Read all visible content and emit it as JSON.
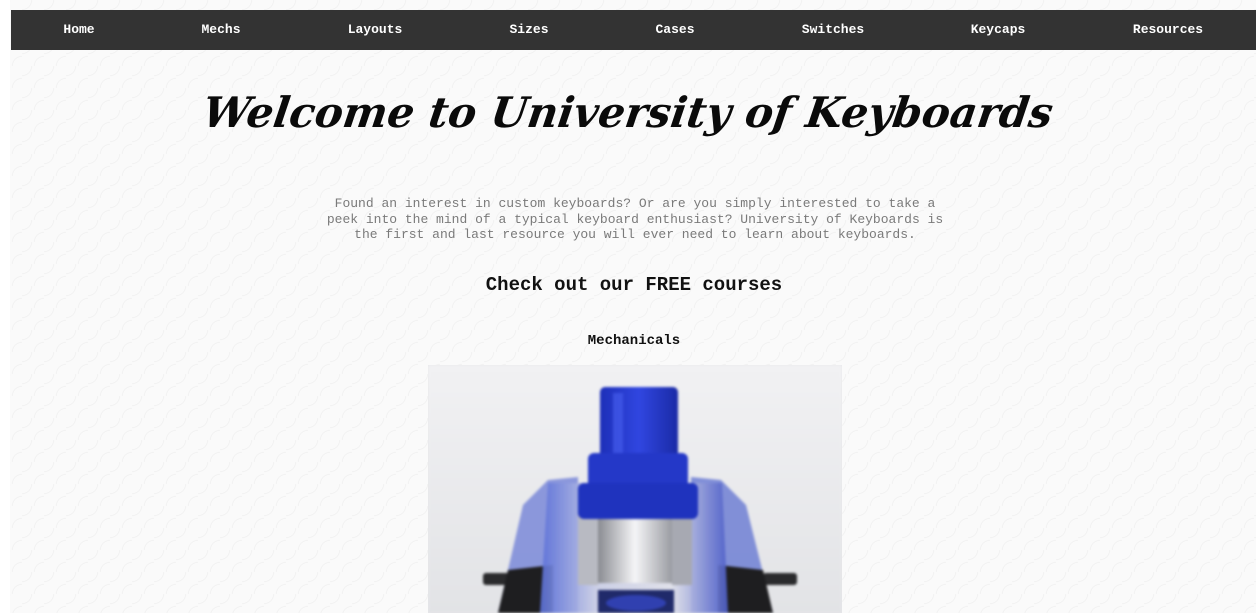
{
  "nav": {
    "items": [
      {
        "label": "Home"
      },
      {
        "label": "Mechs"
      },
      {
        "label": "Layouts"
      },
      {
        "label": "Sizes"
      },
      {
        "label": "Cases"
      },
      {
        "label": "Switches"
      },
      {
        "label": "Keycaps"
      },
      {
        "label": "Resources"
      }
    ]
  },
  "hero": {
    "title": "Welcome to University of Keyboards"
  },
  "intro": {
    "text": "Found an interest in custom keyboards? Or are you simply interested to take a peek into the mind of a typical keyboard enthusiast? University of Keyboards is the first and last resource you will ever need to learn about keyboards."
  },
  "courses": {
    "heading": "Check out our FREE courses",
    "items": [
      {
        "label": "Mechanicals",
        "image_icon": "blue-switch-image"
      }
    ]
  },
  "colors": {
    "nav_bg": "#333333",
    "nav_text": "#ffffff",
    "intro_text": "#7a7a7a",
    "switch_stem": "#2a40d0"
  }
}
